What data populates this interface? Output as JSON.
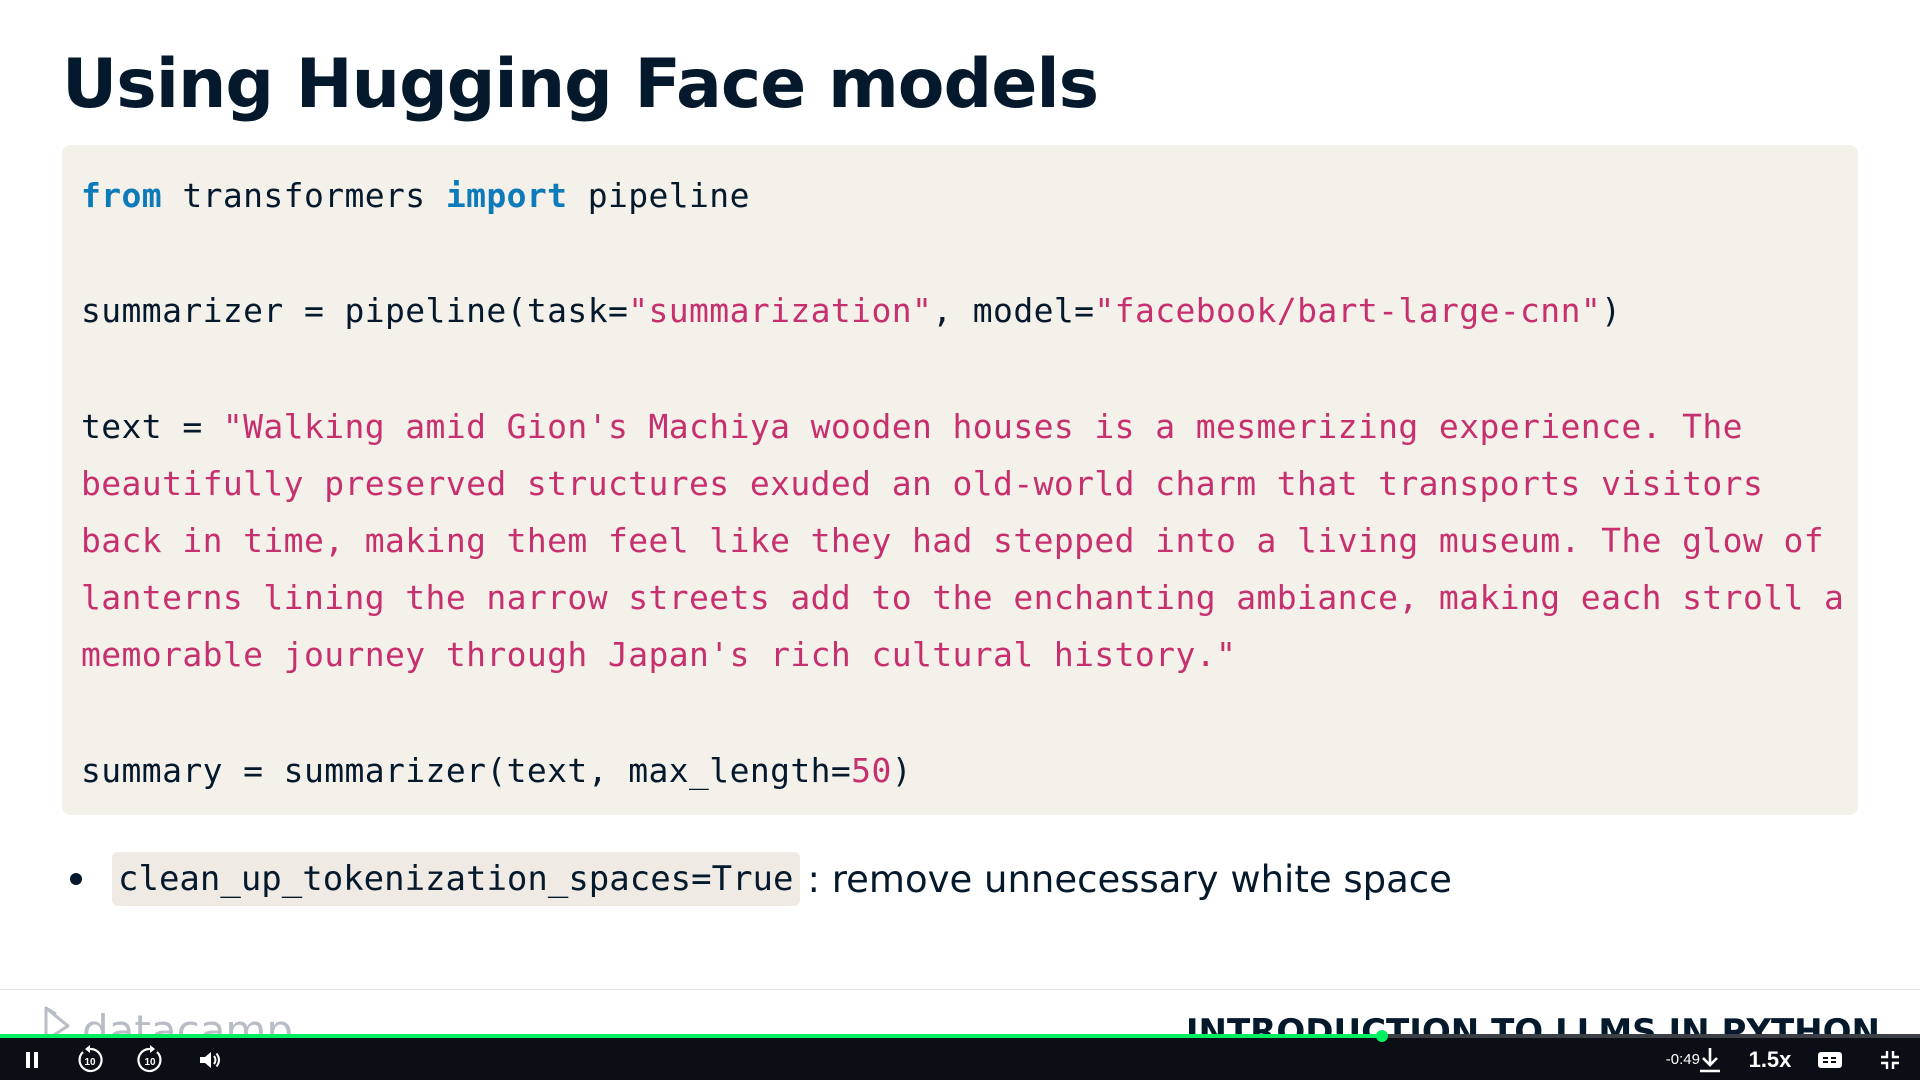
{
  "slide": {
    "title": "Using Hugging Face models"
  },
  "code": {
    "line1": {
      "kw_from": "from",
      "text1": " transformers ",
      "kw_import": "import",
      "text2": " pipeline"
    },
    "line2": {
      "text1": "summarizer = pipeline(task=",
      "str1": "\"summarization\"",
      "text2": ", model=",
      "str2": "\"facebook/bart-large-cnn\"",
      "text3": ")"
    },
    "line3": {
      "text1": "text = ",
      "str1": "\"Walking amid Gion's Machiya wooden houses is a mesmerizing experience. The"
    },
    "line4": "beautifully preserved structures exuded an old-world charm that transports visitors",
    "line5": "back in time, making them feel like they had stepped into a living museum. The glow of",
    "line6": "lanterns lining the narrow streets add to the enchanting ambiance, making each stroll a",
    "line7": "memorable journey through Japan's rich cultural history.\"",
    "line8": {
      "text1": "summary = summarizer(text, max_length=",
      "num": "50",
      "text2": ")"
    }
  },
  "bullet": {
    "code": "clean_up_tokenization_spaces=True",
    "text": ": remove unnecessary white space"
  },
  "footer": {
    "logo_text": "datacamp",
    "course_title": "INTRODUCTION TO LLMS IN PYTHON"
  },
  "player": {
    "progress": 0.72,
    "time_remaining": "-0:49",
    "speed": "1.5x",
    "rewind_seconds": "10",
    "forward_seconds": "10",
    "icons": {
      "pause": "pause-icon",
      "rewind": "rewind-10-icon",
      "forward": "forward-10-icon",
      "volume": "volume-icon",
      "download": "download-icon",
      "captions": "captions-icon",
      "exit_fullscreen": "exit-fullscreen-icon"
    }
  },
  "colors": {
    "keyword": "#0d7bba",
    "string": "#c7306e",
    "code_background": "#f4f0ea",
    "progress": "#03ef62",
    "player_background": "#0b0e14",
    "text": "#05192d"
  }
}
